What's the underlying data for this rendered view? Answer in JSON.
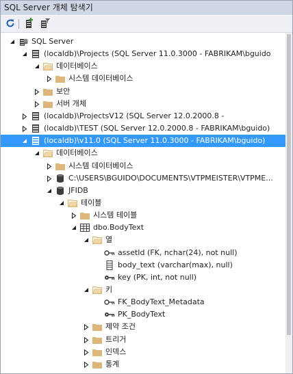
{
  "window": {
    "title": "SQL Server 개체 탐색기"
  },
  "toolbar": {
    "buttons": [
      {
        "name": "refresh-button",
        "icon": "refresh-icon"
      },
      {
        "name": "add-server-button",
        "icon": "add-server-icon"
      },
      {
        "name": "filter-button",
        "icon": "filter-icon"
      }
    ]
  },
  "tree": {
    "nodes": [
      {
        "label": "SQL Server",
        "depth": 0,
        "arrow": "expanded",
        "icon": "sql-server-icon"
      },
      {
        "label": "(localdb)\\Projects (SQL Server 11.0.3000 - FABRIKAM\\bguido",
        "depth": 1,
        "arrow": "expanded",
        "icon": "server-icon"
      },
      {
        "label": "데이터베이스",
        "depth": 2,
        "arrow": "expanded",
        "icon": "folder-open-icon"
      },
      {
        "label": "시스템 데이터베이스",
        "depth": 3,
        "arrow": "collapsed",
        "icon": "folder-icon"
      },
      {
        "label": "보안",
        "depth": 2,
        "arrow": "collapsed",
        "icon": "folder-icon"
      },
      {
        "label": "서버 개체",
        "depth": 2,
        "arrow": "collapsed",
        "icon": "folder-icon"
      },
      {
        "label": "(localdb)\\ProjectsV12 (SQL Server 12.0.2000.8 -",
        "depth": 1,
        "arrow": "collapsed",
        "icon": "server-icon"
      },
      {
        "label": "(localdb)\\TEST (SQL Server 12.0.2000.8 - FABRIKAM\\bguido)",
        "depth": 1,
        "arrow": "collapsed",
        "icon": "server-icon"
      },
      {
        "label": "(localdb)\\v11.0 (SQL Server 11.0.3000 - FABRIKAM\\bguido)",
        "depth": 1,
        "arrow": "expanded",
        "icon": "server-icon",
        "selected": true
      },
      {
        "label": "데이터베이스",
        "depth": 2,
        "arrow": "expanded",
        "icon": "folder-open-icon"
      },
      {
        "label": "시스템 데이터베이스",
        "depth": 3,
        "arrow": "collapsed",
        "icon": "folder-icon"
      },
      {
        "label": "C:\\USERS\\BGUIDO\\DOCUMENTS\\VTPMEISTER\\VTPME...",
        "depth": 3,
        "arrow": "collapsed",
        "icon": "database-icon"
      },
      {
        "label": "JFIDB",
        "depth": 3,
        "arrow": "expanded",
        "icon": "database-icon"
      },
      {
        "label": "테이블",
        "depth": 4,
        "arrow": "expanded",
        "icon": "folder-open-icon"
      },
      {
        "label": "시스템 테이블",
        "depth": 5,
        "arrow": "collapsed",
        "icon": "folder-icon"
      },
      {
        "label": "dbo.BodyText",
        "depth": 5,
        "arrow": "expanded",
        "icon": "table-icon"
      },
      {
        "label": "열",
        "depth": 6,
        "arrow": "expanded",
        "icon": "folder-open-icon"
      },
      {
        "label": "assetId (FK, nchar(24), not null)",
        "depth": 7,
        "arrow": "none",
        "icon": "foreign-key-icon"
      },
      {
        "label": "body_text (varchar(max), null)",
        "depth": 7,
        "arrow": "none",
        "icon": "column-icon"
      },
      {
        "label": "key (PK, int, not null)",
        "depth": 7,
        "arrow": "none",
        "icon": "primary-key-icon"
      },
      {
        "label": "키",
        "depth": 6,
        "arrow": "expanded",
        "icon": "folder-open-icon"
      },
      {
        "label": "FK_BodyText_Metadata",
        "depth": 7,
        "arrow": "none",
        "icon": "foreign-key-icon"
      },
      {
        "label": "PK_BodyText",
        "depth": 7,
        "arrow": "none",
        "icon": "primary-key-icon"
      },
      {
        "label": "제약 조건",
        "depth": 6,
        "arrow": "collapsed",
        "icon": "folder-icon"
      },
      {
        "label": "트리거",
        "depth": 6,
        "arrow": "collapsed",
        "icon": "folder-icon"
      },
      {
        "label": "인덱스",
        "depth": 6,
        "arrow": "collapsed",
        "icon": "folder-icon"
      },
      {
        "label": "통계",
        "depth": 6,
        "arrow": "collapsed",
        "icon": "folder-icon"
      }
    ]
  },
  "colors": {
    "titlebar": "#cfd6e5",
    "selection": "#3399ff",
    "folder": "#dcb67a",
    "server": "#3c3c3c",
    "arrow": "#1e1e1e"
  }
}
